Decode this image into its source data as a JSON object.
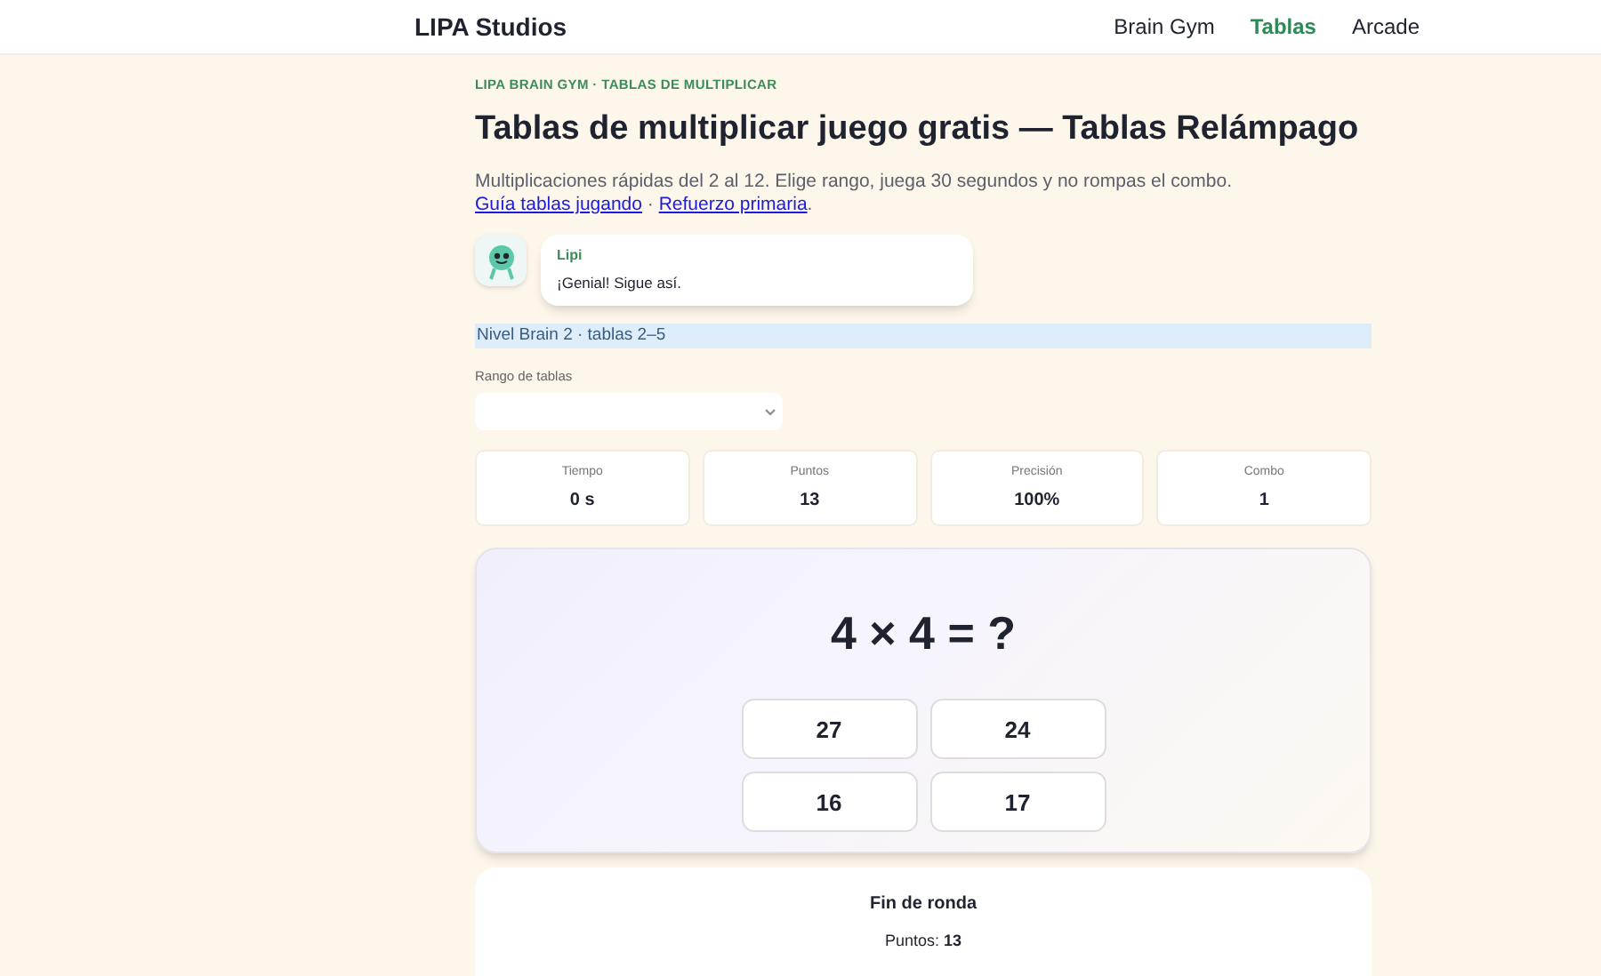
{
  "nav": {
    "brand": "LIPA Studios",
    "links": [
      {
        "label": "Brain Gym",
        "selected": false
      },
      {
        "label": "Tablas",
        "selected": true
      },
      {
        "label": "Arcade",
        "selected": false
      }
    ]
  },
  "eyebrow": "LIPA BRAIN GYM · TABLAS DE MULTIPLICAR",
  "title": "Tablas de multiplicar juego gratis — Tablas Relámpago",
  "intro": {
    "text": "Multiplicaciones rápidas del 2 al 12. Elige rango, juega 30 segundos y no rompas el combo.",
    "links": [
      "Guía tablas jugando",
      "Refuerzo primaria"
    ],
    "separator": "·",
    "end": "."
  },
  "mascot": {
    "name": "Lipi",
    "message": "¡Genial! Sigue así."
  },
  "level_banner": "Nivel Brain 2 · tablas 2–5",
  "range": {
    "label": "Rango de tablas"
  },
  "stats": [
    {
      "label": "Tiempo",
      "value": "0 s"
    },
    {
      "label": "Puntos",
      "value": "13"
    },
    {
      "label": "Precisión",
      "value": "100%"
    },
    {
      "label": "Combo",
      "value": "1"
    }
  ],
  "game": {
    "question": "4 × 4 = ?",
    "answers": [
      "27",
      "24",
      "16",
      "17"
    ]
  },
  "result": {
    "title": "Fin de ronda",
    "score": "Puntos: **13**"
  }
}
